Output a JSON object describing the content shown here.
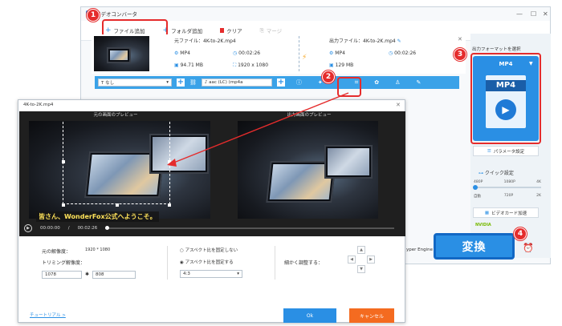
{
  "app": {
    "title": "ビデオコンバータ"
  },
  "toolbar": {
    "add_file": "ファイル追加",
    "add_folder": "フォルダ追加",
    "clear": "クリア",
    "merge": "マージ"
  },
  "source": {
    "label": "元ファイル：",
    "name": "4K-to-2K.mp4",
    "format": "MP4",
    "duration": "00:02:26",
    "size": "94.71 MB",
    "resolution": "1920 x 1080"
  },
  "output": {
    "label": "出力ファイル：",
    "name": "4K-to-2K.mp4",
    "format": "MP4",
    "duration": "00:02:26",
    "size": "129 MB"
  },
  "edit_bar": {
    "subtitle": "なし",
    "audio": "aac (LC) (mp4a"
  },
  "right_panel": {
    "format_label": "出力フォーマットを選択",
    "format_value": "MP4",
    "format_icon_text": "MP4",
    "param_button": "パラメータ設定",
    "quick_label": "クイック設定",
    "quick_top": [
      "480P",
      "1080P",
      "4K"
    ],
    "quick_bottom": [
      "自動",
      "720P",
      "2K"
    ],
    "gpu_button": "ビデオカード加速",
    "nvidia": "NVIDIA",
    "engine_text": "yper Engine"
  },
  "convert": {
    "label": "変換"
  },
  "crop": {
    "title": "4K-to-2K.mp4",
    "left_preview": "元の画面のプレビュー",
    "right_preview": "出力画面のプレビュー",
    "caption": "皆さん、WonderFox公式へようこそ。",
    "time_current": "00:00:00",
    "time_total": "00:02:26",
    "orig_res_label": "元の解像度：",
    "orig_res_value": "1920 * 1080",
    "trim_label": "トリミング解像度：",
    "trim_w": "1078",
    "trim_h": "808",
    "aspect_free": "アスペクト比を固定しない",
    "aspect_fixed": "アスペクト比を固定する",
    "ratio": "4:3",
    "fine_tune": "細かく調整する：",
    "tutorial": "チュートリアル >",
    "ok": "Ok",
    "cancel": "キャンセル"
  },
  "badges": [
    "1",
    "2",
    "3",
    "4"
  ],
  "colors": {
    "accent": "#2a8fe4",
    "highlight": "#e52c2c",
    "cancel": "#f46b20"
  }
}
